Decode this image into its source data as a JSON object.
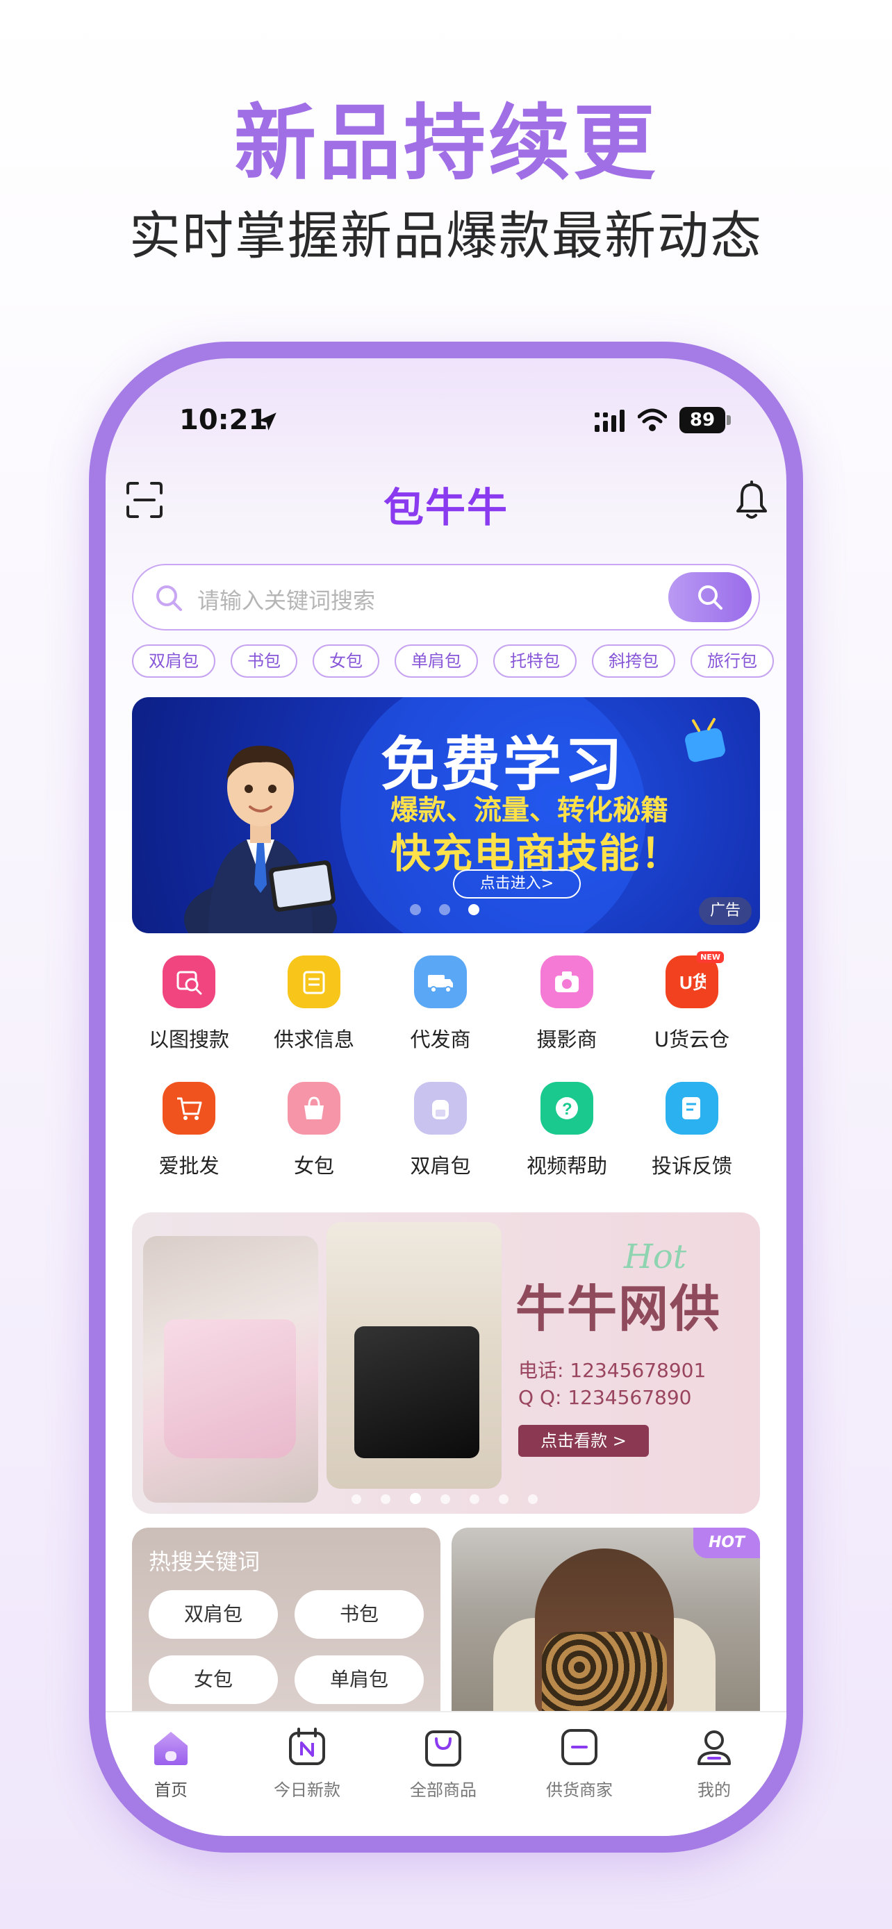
{
  "headline": "新品持续更",
  "subheadline": "实时掌握新品爆款最新动态",
  "status_bar": {
    "time": "10:21",
    "battery": "89"
  },
  "header": {
    "title": "包牛牛"
  },
  "search": {
    "placeholder": "请输入关键词搜索"
  },
  "chips": [
    "双肩包",
    "书包",
    "女包",
    "单肩包",
    "托特包",
    "斜挎包",
    "旅行包"
  ],
  "banner": {
    "title": "免费学习",
    "subtitle1": "爆款、流量、转化秘籍",
    "subtitle2": "快充电商技能！",
    "button": "点击进入>",
    "ad_tag": "广告",
    "slide_count": 3,
    "active_slide": 3
  },
  "categories": [
    {
      "label": "以图搜款",
      "icon": "image-search-icon",
      "color": "#f0457e"
    },
    {
      "label": "供求信息",
      "icon": "supply-demand-icon",
      "color": "#f8c61a"
    },
    {
      "label": "代发商",
      "icon": "truck-icon",
      "color": "#5aa8f5"
    },
    {
      "label": "摄影商",
      "icon": "camera-icon",
      "color": "#f57ad6"
    },
    {
      "label": "U货云仓",
      "icon": "u-warehouse-icon",
      "color": "#f2411f",
      "badge": "NEW"
    },
    {
      "label": "爱批发",
      "icon": "cart-icon",
      "color": "#f1531e"
    },
    {
      "label": "女包",
      "icon": "handbag-icon",
      "color": "#f695a8"
    },
    {
      "label": "双肩包",
      "icon": "backpack-icon",
      "color": "#c9c3f0"
    },
    {
      "label": "视频帮助",
      "icon": "help-icon",
      "color": "#19c98e"
    },
    {
      "label": "投诉反馈",
      "icon": "feedback-icon",
      "color": "#2bb0f0"
    }
  ],
  "promo": {
    "hot": "Hot",
    "title": "牛牛网供",
    "phone": "电话: 12345678901",
    "qq": "Q Q: 1234567890",
    "button": "点击看款 >",
    "slide_count": 7,
    "active_slide": 3
  },
  "hot_keywords": {
    "title": "热搜关键词",
    "items": [
      "双肩包",
      "书包",
      "女包",
      "单肩包"
    ]
  },
  "photo_card": {
    "badge": "HOT"
  },
  "tabbar": [
    {
      "label": "首页",
      "icon": "home-icon",
      "active": true
    },
    {
      "label": "今日新款",
      "icon": "new-calendar-icon",
      "active": false
    },
    {
      "label": "全部商品",
      "icon": "shopping-bag-icon",
      "active": false
    },
    {
      "label": "供货商家",
      "icon": "supplier-icon",
      "active": false
    },
    {
      "label": "我的",
      "icon": "profile-icon",
      "active": false
    }
  ],
  "colors": {
    "accent": "#a06fe6",
    "brand": "#8a3bf0",
    "phone_frame": "#a57be6"
  }
}
